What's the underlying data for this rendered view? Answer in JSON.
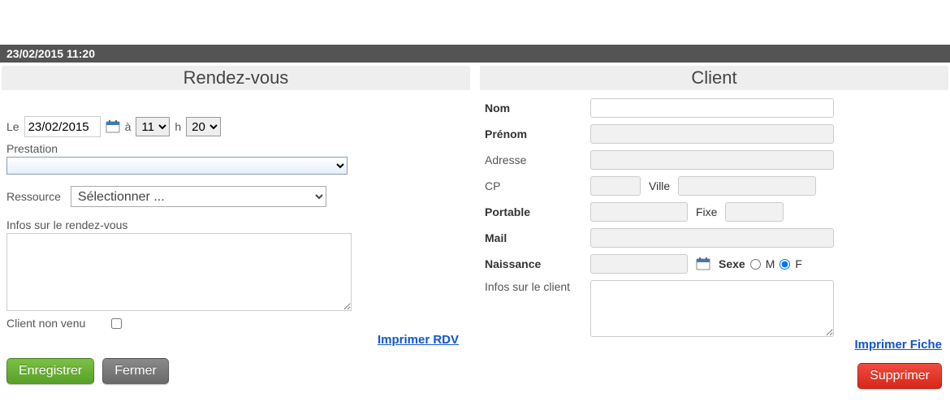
{
  "topbar": {
    "datetime": "23/02/2015 11:20"
  },
  "rdv": {
    "title": "Rendez-vous",
    "le": "Le",
    "date": "23/02/2015",
    "a": "à",
    "hour": "11",
    "h": "h",
    "minute": "20",
    "prestation_label": "Prestation",
    "prestation_value": "",
    "ressource_label": "Ressource",
    "ressource_value": "Sélectionner ...",
    "notes_label": "Infos sur le rendez-vous",
    "notes": "",
    "noshow_label": "Client non venu",
    "print_link": "Imprimer RDV",
    "save_btn": "Enregistrer",
    "close_btn": "Fermer"
  },
  "client": {
    "title": "Client",
    "nom_label": "Nom",
    "prenom_label": "Prénom",
    "adresse_label": "Adresse",
    "cp_label": "CP",
    "ville_label": "Ville",
    "portable_label": "Portable",
    "fixe_label": "Fixe",
    "mail_label": "Mail",
    "naissance_label": "Naissance",
    "sexe_label": "Sexe",
    "sexe_m": "M",
    "sexe_f": "F",
    "notes_label": "Infos sur le client",
    "print_link": "Imprimer Fiche",
    "delete_btn": "Supprimer"
  }
}
